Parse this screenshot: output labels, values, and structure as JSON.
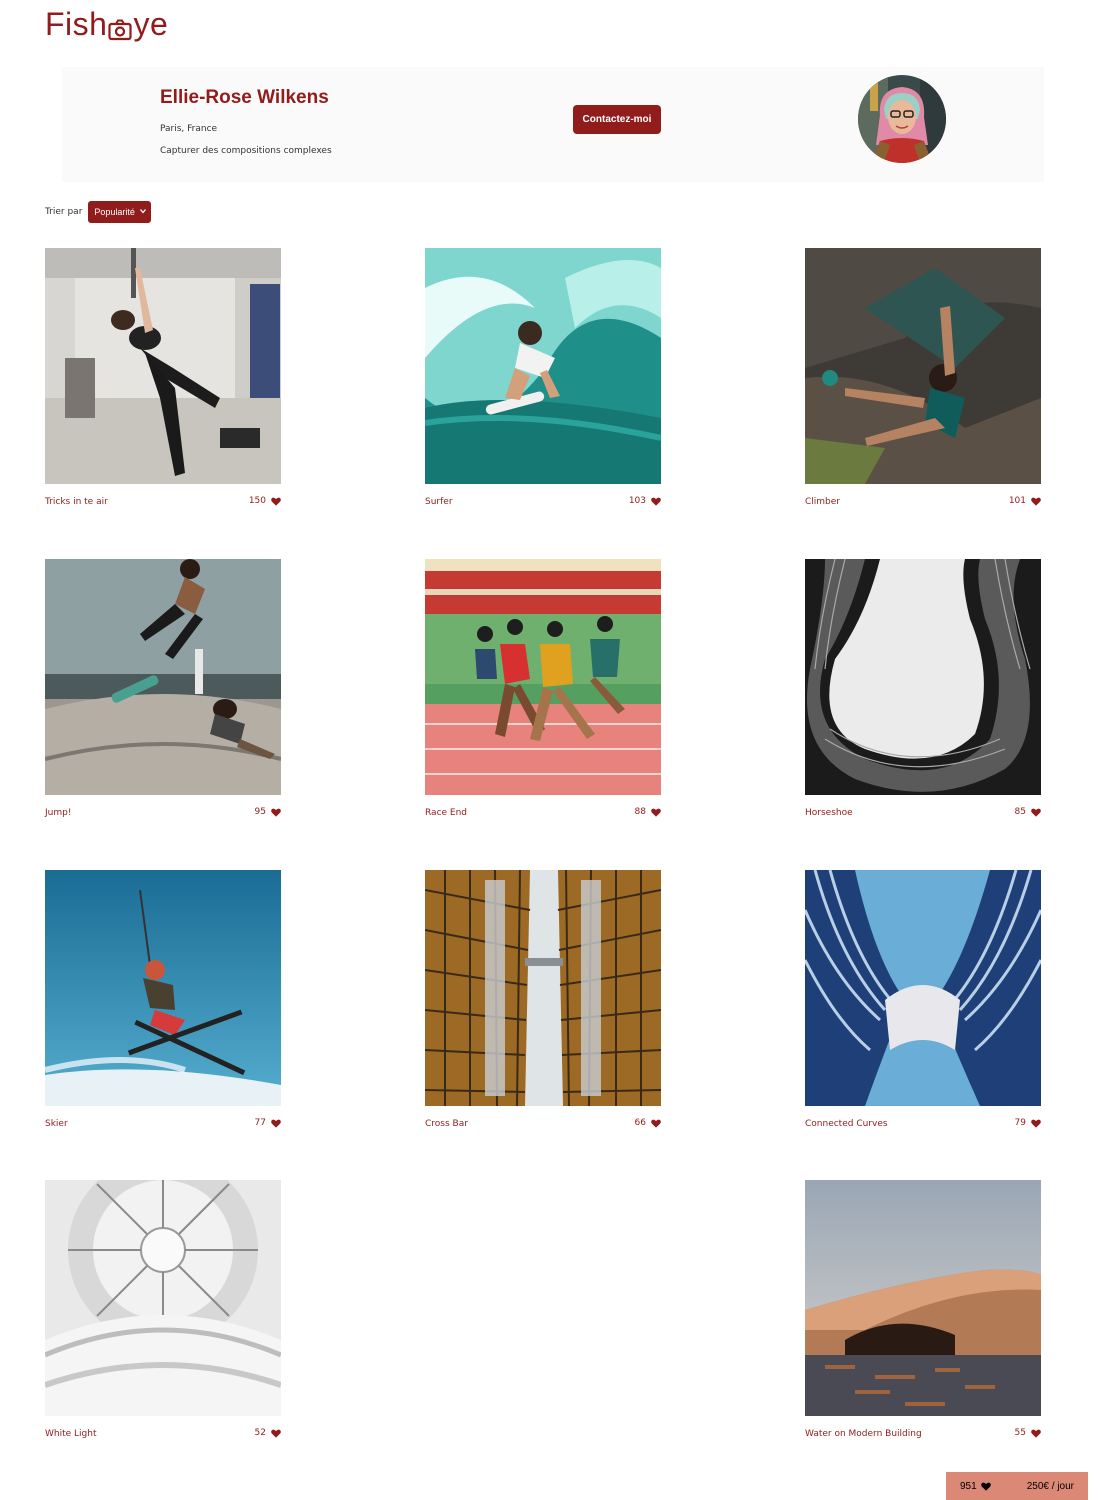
{
  "logo": {
    "text_before": "Fish",
    "text_after": "ye"
  },
  "photographer": {
    "name": "Ellie-Rose Wilkens",
    "location": "Paris, France",
    "tagline": "Capturer des compositions complexes",
    "contact_label": "Contactez-moi"
  },
  "sort": {
    "label": "Trier par",
    "selected": "Popularité"
  },
  "media": [
    {
      "title": "Tricks in te air",
      "likes": "150",
      "icon": "heart-icon"
    },
    {
      "title": "Surfer",
      "likes": "103",
      "icon": "heart-icon"
    },
    {
      "title": "Climber",
      "likes": "101",
      "icon": "heart-icon"
    },
    {
      "title": "Jump!",
      "likes": "95",
      "icon": "heart-icon"
    },
    {
      "title": "Race End",
      "likes": "88",
      "icon": "heart-icon"
    },
    {
      "title": "Horseshoe",
      "likes": "85",
      "icon": "heart-icon"
    },
    {
      "title": "Skier",
      "likes": "77",
      "icon": "heart-icon"
    },
    {
      "title": "Cross Bar",
      "likes": "66",
      "icon": "heart-icon"
    },
    {
      "title": "Connected Curves",
      "likes": "79",
      "icon": "heart-icon"
    },
    {
      "title": "White Light",
      "likes": "52",
      "icon": "heart-icon"
    },
    {
      "title": "Water on Modern Building",
      "likes": "55",
      "icon": "heart-icon"
    }
  ],
  "footer": {
    "total_likes": "951",
    "price": "250€ / jour"
  },
  "colors": {
    "primary": "#901C1C",
    "secondary": "#DB8876",
    "header_bg": "#FAFAFA"
  }
}
